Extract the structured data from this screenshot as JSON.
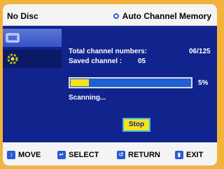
{
  "header": {
    "title": "No Disc",
    "right_label": "Auto Channel Memory"
  },
  "content": {
    "total_label": "Total channel numbers:",
    "total_value": "06/125",
    "saved_label": "Saved channel :",
    "saved_value": "05",
    "progress_percent_text": "5%",
    "progress_fraction": 0.05,
    "status": "Scanning...",
    "stop_label": "Stop"
  },
  "footer": {
    "move": "MOVE",
    "select": "SELECT",
    "return": "RETURN",
    "exit": "EXIT"
  },
  "colors": {
    "background": "#11238c",
    "frame": "#f2b33a",
    "progress_bar": "#1f5fd6",
    "progress_fill": "#f6e41a",
    "accent": "#2a5bd7"
  },
  "icons": {
    "header": "radio-dot-icon",
    "move": "up-down-arrows-icon",
    "select": "select-enter-icon",
    "return": "return-arrow-icon",
    "exit": "exit-icon"
  }
}
